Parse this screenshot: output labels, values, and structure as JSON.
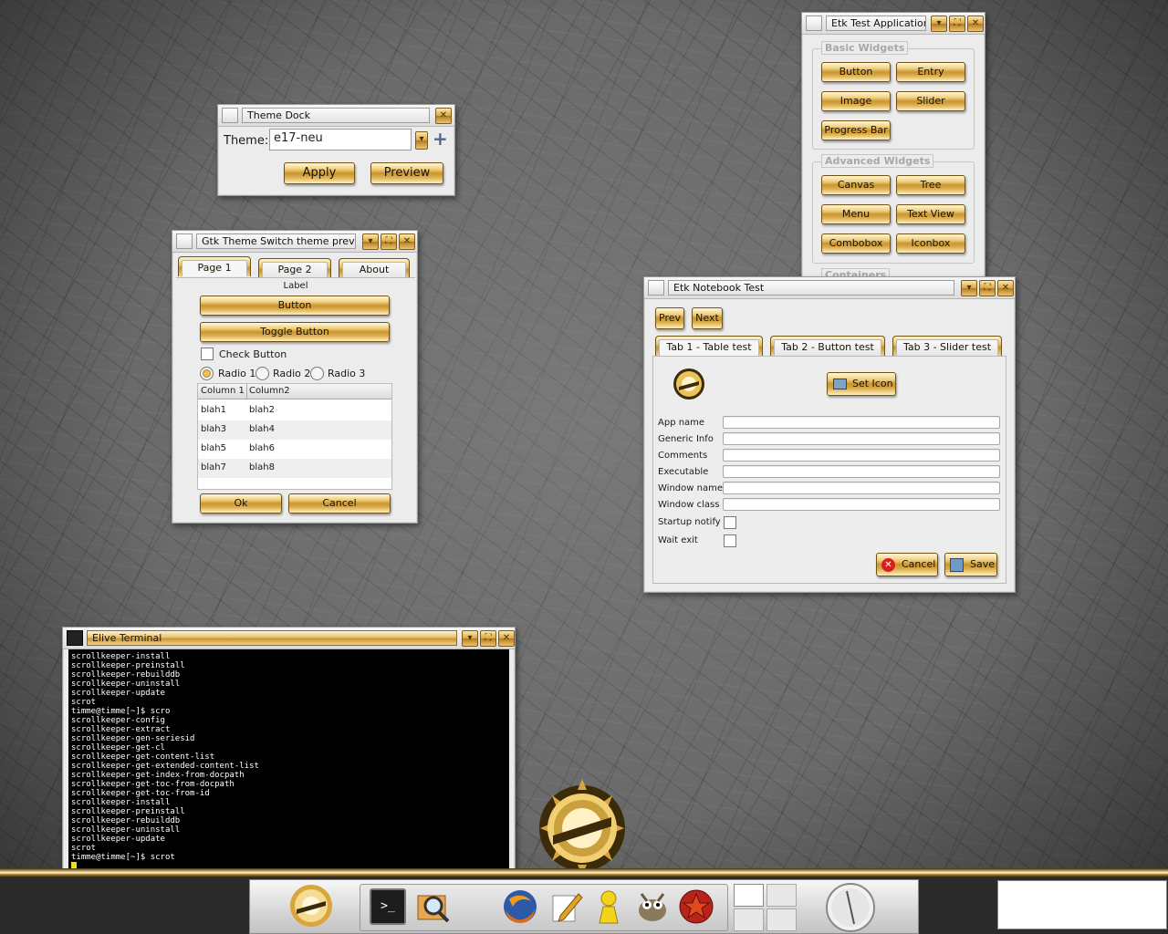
{
  "theme_dock": {
    "title": "Theme Dock",
    "close_icon": "close-icon",
    "theme_label": "Theme:",
    "theme_value": "e17-neu",
    "apply_label": "Apply",
    "preview_label": "Preview"
  },
  "gtk_preview": {
    "title": "Gtk Theme Switch theme previ...",
    "tabs": [
      "Page 1",
      "Page 2",
      "About"
    ],
    "label_text": "Label",
    "button_label": "Button",
    "toggle_button_label": "Toggle Button",
    "check_button_label": "Check Button",
    "radio1_label": "Radio 1",
    "radio2_label": "Radio 2",
    "radio3_label": "Radio 3",
    "columns": [
      "Column 1",
      "Column2"
    ],
    "rows": [
      [
        "blah1",
        "blah2"
      ],
      [
        "blah3",
        "blah4"
      ],
      [
        "blah5",
        "blah6"
      ],
      [
        "blah7",
        "blah8"
      ]
    ],
    "ok_label": "Ok",
    "cancel_label": "Cancel"
  },
  "etk_app": {
    "title": "Etk Test Application",
    "basic_widgets_label": "Basic Widgets",
    "basic_buttons": [
      "Button",
      "Entry",
      "Image",
      "Slider",
      "Progress Bar"
    ],
    "advanced_widgets_label": "Advanced Widgets",
    "advanced_buttons": [
      "Canvas",
      "Tree",
      "Menu",
      "Text View",
      "Combobox",
      "Iconbox"
    ],
    "containers_label": "Containers"
  },
  "etk_notebook": {
    "title": "Etk Notebook Test",
    "prev_label": "Prev",
    "next_label": "Next",
    "tabs": [
      "Tab 1 - Table test",
      "Tab 2 - Button test",
      "Tab 3 - Slider test"
    ],
    "set_icon_label": "Set Icon",
    "fields": [
      "App name",
      "Generic Info",
      "Comments",
      "Executable",
      "Window name",
      "Window class"
    ],
    "startup_notify_label": "Startup notify",
    "wait_exit_label": "Wait exit",
    "cancel_label": "Cancel",
    "save_label": "Save"
  },
  "terminal": {
    "title": "Elive Terminal",
    "lines": [
      "scrollkeeper-install",
      "scrollkeeper-preinstall",
      "scrollkeeper-rebuilddb",
      "scrollkeeper-uninstall",
      "scrollkeeper-update",
      "scrot",
      "timme@timme[~]$ scro",
      "scrollkeeper-config",
      "scrollkeeper-extract",
      "scrollkeeper-gen-seriesid",
      "scrollkeeper-get-cl",
      "scrollkeeper-get-content-list",
      "scrollkeeper-get-extended-content-list",
      "scrollkeeper-get-index-from-docpath",
      "scrollkeeper-get-toc-from-docpath",
      "scrollkeeper-get-toc-from-id",
      "scrollkeeper-install",
      "scrollkeeper-preinstall",
      "scrollkeeper-rebuilddb",
      "scrollkeeper-uninstall",
      "scrollkeeper-update",
      "scrot",
      "timme@timme[~]$ scrot"
    ]
  },
  "shelf": {
    "launchers": [
      "terminal-icon",
      "search-icon",
      "firefox-icon",
      "text-editor-icon",
      "messenger-icon",
      "gimp-icon",
      "media-player-icon"
    ],
    "pager_icon": "pager-icon",
    "clock_icon": "clock-icon"
  },
  "colors": {
    "gold": "#c9952e",
    "gold_light": "#fff0c0",
    "window_bg": "#ececec",
    "terminal_bg": "#000000",
    "cursor": "#f2e200"
  }
}
